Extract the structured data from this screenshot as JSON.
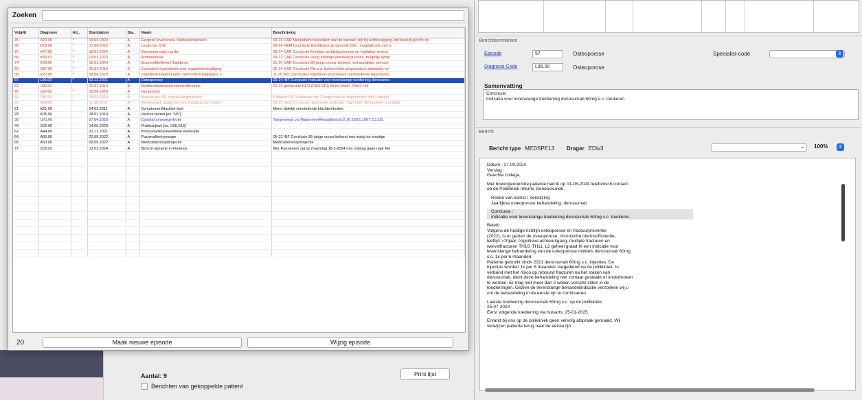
{
  "episode_window": {
    "search_label": "Zoeken",
    "search_value": "",
    "columns": [
      "VolgNr",
      "Diagnose",
      "Att..",
      "Startdatum",
      "Sta..",
      "Naam",
      "Beschrijving"
    ],
    "rows": [
      {
        "style": "red",
        "cells": [
          "76",
          "A20.00",
          "*",
          "04.03.2024",
          "A",
          "Gesprek levensnota / behandelwensen",
          "03-24 CAR Met patient besproken wat de wensen zijn bij achteruitgang, dat besluit gericht op"
        ]
      },
      {
        "style": "red",
        "cells": [
          "66",
          "B73.00",
          "*",
          "17.06.2022",
          "A",
          "Leukemie CHL",
          "09-24 HEM Conclusie Hoofdsteun progressie CHL, mogelijk ook met h"
        ]
      },
      {
        "style": "red",
        "cells": [
          "73",
          "K77.00",
          "*",
          "18.01.2024",
          "A",
          "Decompensatio cordis",
          "08-24 CAR Conclusie Ernstige aortaklepstenose en hartfalen, tevens"
        ]
      },
      {
        "style": "red",
        "cells": [
          "58",
          "K83.01",
          "*",
          "03.03.2023",
          "A",
          "Aortastenose",
          "05-22 CAR Conclusie Hoog ernstige aortaklepstenose, mogelijk symp"
        ]
      },
      {
        "style": "red",
        "cells": [
          "74",
          "K78.00",
          "*",
          "12.01.2024",
          "A",
          "Boezemfibrilleren/-fladderen",
          "01-24 CAR Conclusie 86-jarige vrouw, bekend met aortaklep stenose"
        ]
      },
      {
        "style": "red",
        "cells": [
          "50",
          "K87.00",
          "*",
          "09.04.2019",
          "A",
          "Essentiele hypertensie met orgaanbeschadiging",
          "05-24 CAR Conclusie Pte s.a. bekend met progressieve dementie, eri"
        ]
      },
      {
        "style": "red",
        "cells": [
          "38",
          "P20.00",
          "*",
          "08.04.2020",
          "A",
          "cognitieve beperkingen, verminderd begrijpen, v...",
          "11-20 MO Conclusie Cognitieve stoornissen (verminderde reproductie"
        ]
      },
      {
        "style": "sel",
        "cells": [
          "57",
          "L95.00",
          "*",
          "03.12.2021",
          "A",
          "Osteoporose",
          "05-24 INT Conclusie Indicatie voor levenslange toediening denosuma"
        ]
      },
      {
        "style": "red",
        "cells": [
          "52",
          "U99.01",
          "",
          "20.07.2019",
          "A",
          "Nierfunctiestoornis/nierinsufficientie",
          "01-24 gecheckte GFR (CKD-EPI)              54 mL/min/1.73m2 <54"
        ]
      },
      {
        "style": "red",
        "cells": [
          "45",
          "L99.00",
          "*",
          "18.06.2020",
          "A",
          "Gonartrose",
          ""
        ]
      },
      {
        "style": "pale",
        "cells": [
          "31",
          "F84.00",
          "*",
          "18.03.2019",
          "A",
          "Macula gat OD, macula degeneratie",
          "Cataract OD 1 cataract ods 2 lange macula degeneratie ods 3 pucker"
        ]
      },
      {
        "style": "pale",
        "cells": [
          "25",
          "N04.00",
          "*",
          "11.09.2022",
          "A",
          "Restlessgel, anaal met beschadiging van mede...",
          "09-22 NEU Conclusie: gestoorde evaluatie *sigmoïde, Behandelen Lumbaal"
        ]
      },
      {
        "style": "black",
        "cells": [
          "21",
          "K21.00",
          "",
          "04.03.2011",
          "A",
          "Symptomen/klachten kuit",
          "Mene tijdelijk verminderde klachten/kuiten."
        ]
      },
      {
        "style": "black",
        "cells": [
          "22",
          "K95.00",
          "",
          "18.01.2010",
          "A",
          "Varices benen [ex. S97]",
          ""
        ]
      },
      {
        "style": "blue",
        "cells": [
          "39",
          "U71.00",
          "",
          "27.04.2020",
          "A",
          "Cystitis/urineweginfectie",
          "Toegevoegd via WaarneemRetourBericht 2.16.528.1.1007.3.3.151"
        ]
      },
      {
        "style": "black",
        "cells": [
          "44",
          "S02.00",
          "",
          "14.05.2020",
          "A",
          "Pruritus/jeuk [ex. S05,S16]",
          ""
        ]
      },
      {
        "style": "black",
        "cells": [
          "62",
          "A44.00",
          "",
          "31.12.2021",
          "A",
          "Immunisatie/preventieve medicatie",
          ""
        ]
      },
      {
        "style": "black",
        "cells": [
          "64",
          "A06.00",
          "",
          "22.05.2022",
          "A",
          "Flauwvallen/syncope",
          "05-22 INT Conclusie 85-jarige vrouw bekend met matig tot ernstige"
        ]
      },
      {
        "style": "black",
        "cells": [
          "65",
          "A50.00",
          "",
          "09.06.2022",
          "A",
          "Medicatie/recept/injectie",
          "Medicatie/recept/injectie"
        ]
      },
      {
        "style": "black",
        "cells": [
          "77",
          "Z03.00",
          "",
          "13.03.2024",
          "A",
          "Bericht opname in Florence",
          "Mw. Pannemen zal op maandag 18-3-2024 met ontslag gaan naar Flo"
        ]
      }
    ],
    "count": "20",
    "new_episode_label": "Maak nieuwe episode",
    "edit_episode_label": "Wijzig episode"
  },
  "background_panel": {
    "aantal_label": "Aantal: 9",
    "print_label": "Print lijst",
    "checkbox_label": "Berichten van gekoppelde patient"
  },
  "right_panel": {
    "section_remarks": "Berichtkenmerken",
    "episode_link": "Episode",
    "episode_code": "57",
    "episode_name": "Osteoporose",
    "diagnose_link": "Diagnose Code",
    "diagnose_code": "L95.00",
    "diagnose_name": "Osteoporose",
    "specialist_label": "Specialist-code",
    "samenvatting_title": "Samenvatting",
    "samenvatting_lines": [
      "Conclusie :",
      "Indicatie voor levenslange toediening denosumab 60mg s.c. toedienin."
    ],
    "section_viewer": "Bericht",
    "berichttype_label": "Bericht type",
    "berichttype_value": "MEDSPE13",
    "drager_label": "Drager",
    "drager_value": "EDIv3",
    "zoom": "100%",
    "letter": [
      "Datum : 27.09.2024\nVerslag :\n   Geachte collega,",
      "Met bovengenoemde patiente had ik op 01-08-2024 telefonisch contact\nop de Polikliniek Interne Geneeskunde.",
      "Reden van komst / Verwijzing\nJaarlijkse osteoporose behandeling: denosumab",
      "Conclusie :\nIndicatie voor levenslange toediening denosumab 60mg s.c. toedienin.",
      "Beleid\nVolgens de huidige richtlijn osteoporose en fractuurpreventie\n(2022), is er gezien de osteoporose, chronische nierinsufficientie,\nleeftijd >70jaar, cognitieve achteruitgang, multiple fracturen en\nwervelfracturen TH10, TH11, L2 geheel graad III een indicatie voor\nlevenslange behandeling van de osteoporose middels denosumab 60mg\ns.c. 1x per 6 maanden.\nPatiente gebruikt sinds 2021 denosumab 60mg s.c. injecties. De\ninjecties worden 1x per 6 maanden toegediend op de polikliniek. In\nverband met het risico op rebound fracturen na het staken van\ndenosumab, dient deze behandeling niet zomaar gestaakt of onderbroken\nte worden. Er mag niet meer dan 2 weken verschil zitten in de\ntoedieningen. Gezien de levenslange behandelindicatie verzoeken wij u\nom de behandeling in de eerste lijn te continueren.",
      "Laatste toediening denosumab 60mg s.c. op de polikliniek:\n25-07-2024\n   Eerst volgende toediening via huisarts:     25-01-2025",
      "Ervand bij ons op de polikliniek geen vervolg afspraak gemaakt. Wij\nverwijzen patiente terug naar de eerste lijn."
    ]
  }
}
